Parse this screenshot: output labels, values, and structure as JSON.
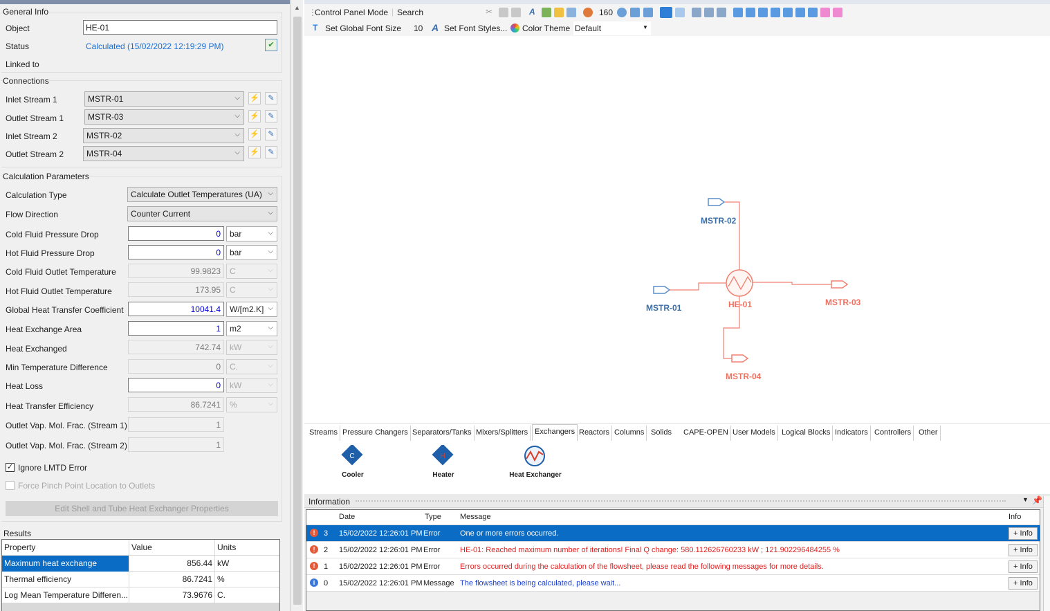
{
  "general": {
    "title": "General Info",
    "object_label": "Object",
    "object_value": "HE-01",
    "status_label": "Status",
    "status_value": "Calculated (15/02/2022 12:19:29 PM)",
    "linked_label": "Linked to"
  },
  "connections": {
    "title": "Connections",
    "rows": [
      {
        "label": "Inlet Stream 1",
        "value": "MSTR-01"
      },
      {
        "label": "Outlet Stream 1",
        "value": "MSTR-03"
      },
      {
        "label": "Inlet Stream 2",
        "value": "MSTR-02"
      },
      {
        "label": "Outlet Stream 2",
        "value": "MSTR-04"
      }
    ]
  },
  "calc": {
    "title": "Calculation Parameters",
    "calc_type_label": "Calculation Type",
    "calc_type_value": "Calculate Outlet Temperatures (UA)",
    "flow_dir_label": "Flow Direction",
    "flow_dir_value": "Counter Current",
    "params": [
      {
        "label": "Cold Fluid Pressure Drop",
        "value": "0",
        "unit": "bar"
      },
      {
        "label": "Hot Fluid Pressure Drop",
        "value": "0",
        "unit": "bar"
      },
      {
        "label": "Cold Fluid Outlet Temperature",
        "value": "99.9823",
        "unit": "C"
      },
      {
        "label": "Hot Fluid Outlet Temperature",
        "value": "173.95",
        "unit": "C"
      },
      {
        "label": "Global Heat Transfer Coefficient",
        "value": "10041.4",
        "unit": "W/[m2.K]"
      },
      {
        "label": "Heat Exchange Area",
        "value": "1",
        "unit": "m2"
      },
      {
        "label": "Heat Exchanged",
        "value": "742.74",
        "unit": "kW"
      },
      {
        "label": "Min Temperature Difference",
        "value": "0",
        "unit": "C."
      },
      {
        "label": "Heat Loss",
        "value": "0",
        "unit": "kW"
      },
      {
        "label": "Heat Transfer Efficiency",
        "value": "86.7241",
        "unit": "%"
      },
      {
        "label": "Outlet Vap. Mol. Frac. (Stream 1)",
        "value": "1"
      },
      {
        "label": "Outlet Vap. Mol. Frac. (Stream 2)",
        "value": "1"
      }
    ],
    "ignore_lmtd": "Ignore LMTD Error",
    "force_pinch": "Force Pinch Point Location to Outlets",
    "edit_button": "Edit Shell and Tube Heat Exchanger Properties"
  },
  "results": {
    "title": "Results",
    "headers": [
      "Property",
      "Value",
      "Units"
    ],
    "rows": [
      {
        "property": "Maximum heat exchange",
        "value": "856.44",
        "units": "kW"
      },
      {
        "property": "Thermal efficiency",
        "value": "86.7241",
        "units": "%"
      },
      {
        "property": "Log Mean Temperature Differen...",
        "value": "73.9676",
        "units": "C."
      }
    ]
  },
  "toolbar": {
    "control_panel": "Control Panel Mode",
    "search": "Search",
    "zoom": "160",
    "font_size_label": "Set Global Font Size",
    "font_size_value": "10",
    "font_styles": "Set Font Styles...",
    "color_theme_label": "Color Theme",
    "color_theme_value": "Default"
  },
  "flowsheet": {
    "streams": [
      "MSTR-02",
      "MSTR-01",
      "HE-01",
      "MSTR-03",
      "MSTR-04"
    ],
    "cold_color": "#5a8fc8",
    "hot_color": "#f08070"
  },
  "palette": {
    "tabs": [
      "Streams",
      "Pressure Changers",
      "Separators/Tanks",
      "Mixers/Splitters",
      "Exchangers",
      "Reactors",
      "Columns",
      "Solids",
      "CAPE-OPEN",
      "User Models",
      "Logical Blocks",
      "Indicators",
      "Controllers",
      "Other"
    ],
    "items": [
      "Cooler",
      "Heater",
      "Heat Exchanger"
    ]
  },
  "info": {
    "title": "Information",
    "headers": [
      "Date",
      "Type",
      "Message",
      "Info"
    ],
    "rows": [
      {
        "n": "3",
        "date": "15/02/2022 12:26:01 PM",
        "type": "Error",
        "msg": "One or more errors occurred.",
        "btn": "+ Info"
      },
      {
        "n": "2",
        "date": "15/02/2022 12:26:01 PM",
        "type": "Error",
        "msg": "HE-01: Reached maximum number of iterations! Final Q change: 580.112626760233 kW ; 121.902296484255 %",
        "btn": "+ Info"
      },
      {
        "n": "1",
        "date": "15/02/2022 12:26:01 PM",
        "type": "Error",
        "msg": "Errors occurred during the calculation of the flowsheet, please read the following messages for more details.",
        "btn": "+ Info"
      },
      {
        "n": "0",
        "date": "15/02/2022 12:26:01 PM",
        "type": "Message",
        "msg": "The flowsheet is being calculated, please wait...",
        "btn": "+ Info"
      }
    ]
  }
}
